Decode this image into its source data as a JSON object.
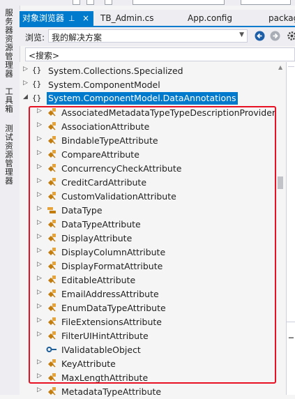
{
  "window": {
    "active_tab": {
      "label": "对象浏览器",
      "pin_glyph": "⊥",
      "close_glyph": "×"
    },
    "tabs": [
      "TB_Admin.cs",
      "App.config",
      "packag"
    ]
  },
  "side_panels": [
    "服务器资源管理器",
    "工具箱",
    "测试资源管理器"
  ],
  "toolbar": {
    "browse_label": "浏览:",
    "browse_value": "我的解决方案",
    "back_icon": "back-arrow-icon",
    "forward_icon": "forward-arrow-icon",
    "settings_icon": "gear-icon"
  },
  "search": {
    "value": "<搜索>"
  },
  "tree": {
    "namespaces": [
      {
        "label": "System.Collections.Specialized",
        "expanded": false
      },
      {
        "label": "System.ComponentModel",
        "expanded": false
      },
      {
        "label": "System.ComponentModel.DataAnnotations",
        "expanded": true,
        "selected": true
      }
    ],
    "children": [
      {
        "label": "AssociatedMetadataTypeTypeDescriptionProvider",
        "kind": "class"
      },
      {
        "label": "AssociationAttribute",
        "kind": "class"
      },
      {
        "label": "BindableTypeAttribute",
        "kind": "class"
      },
      {
        "label": "CompareAttribute",
        "kind": "class"
      },
      {
        "label": "ConcurrencyCheckAttribute",
        "kind": "class"
      },
      {
        "label": "CreditCardAttribute",
        "kind": "class"
      },
      {
        "label": "CustomValidationAttribute",
        "kind": "class"
      },
      {
        "label": "DataType",
        "kind": "enum"
      },
      {
        "label": "DataTypeAttribute",
        "kind": "class"
      },
      {
        "label": "DisplayAttribute",
        "kind": "class"
      },
      {
        "label": "DisplayColumnAttribute",
        "kind": "class"
      },
      {
        "label": "DisplayFormatAttribute",
        "kind": "class"
      },
      {
        "label": "EditableAttribute",
        "kind": "class"
      },
      {
        "label": "EmailAddressAttribute",
        "kind": "class"
      },
      {
        "label": "EnumDataTypeAttribute",
        "kind": "class"
      },
      {
        "label": "FileExtensionsAttribute",
        "kind": "class"
      },
      {
        "label": "FilterUIHintAttribute",
        "kind": "class"
      },
      {
        "label": "IValidatableObject",
        "kind": "interface"
      },
      {
        "label": "KeyAttribute",
        "kind": "class"
      },
      {
        "label": "MaxLengthAttribute",
        "kind": "class"
      },
      {
        "label": "MetadataTypeAttribute",
        "kind": "class"
      }
    ]
  },
  "colors": {
    "accent": "#007acc",
    "highlight_box": "#e81123",
    "class_icon": "#c27d0e",
    "interface_icon": "#1f5f99"
  }
}
